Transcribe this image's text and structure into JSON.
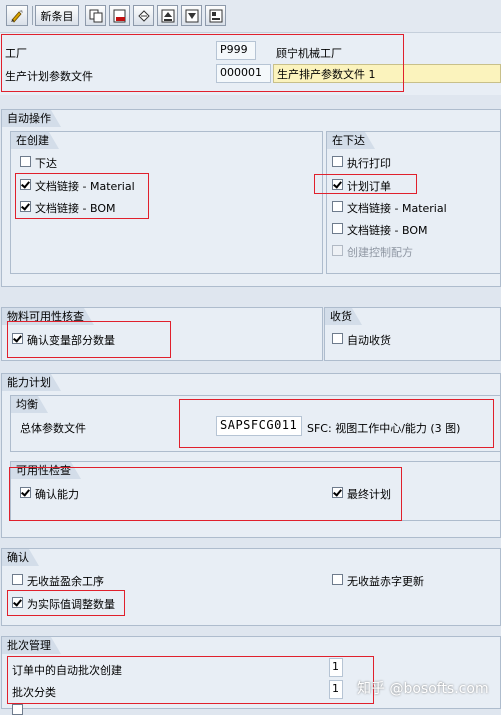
{
  "toolbar": {
    "new_entries_label": "新条目",
    "icons": [
      "edit-toggle-icon",
      "copy-icon",
      "delete-icon",
      "undo-icon",
      "select-all-icon",
      "deselect-icon",
      "details-icon"
    ]
  },
  "header": {
    "plant_label": "工厂",
    "plant_code": "P999",
    "plant_name": "顾宁机械工厂",
    "profile_label": "生产计划参数文件",
    "profile_code": "000001",
    "profile_desc": "生产排产参数文件 1"
  },
  "auto_actions": {
    "title": "自动操作",
    "on_create": {
      "title": "在创建",
      "release": {
        "label": "下达",
        "checked": false
      },
      "doc_link_material": {
        "label": "文档链接 - Material",
        "checked": true
      },
      "doc_link_bom": {
        "label": "文档链接 - BOM",
        "checked": true
      }
    },
    "on_release": {
      "title": "在下达",
      "execute_print": {
        "label": "执行打印",
        "checked": false
      },
      "planned_order": {
        "label": "计划订单",
        "checked": true
      },
      "doc_link_material": {
        "label": "文档链接 - Material",
        "checked": false
      },
      "doc_link_bom": {
        "label": "文档链接 - BOM",
        "checked": false
      },
      "create_control_recipe": {
        "label": "创建控制配方",
        "checked": false,
        "disabled": true
      }
    }
  },
  "material_check": {
    "title": "物料可用性核查",
    "confirm_variable_qty": {
      "label": "确认变量部分数量",
      "checked": true
    }
  },
  "goods_receipt": {
    "title": "收货",
    "auto_gr": {
      "label": "自动收货",
      "checked": false
    }
  },
  "capacity_planning": {
    "title": "能力计划",
    "leveling": {
      "title": "均衡",
      "overall_profile_label": "总体参数文件",
      "overall_profile_value": "SAPSFCG011",
      "overall_profile_desc": "SFC: 视图工作中心/能力 (3 图)"
    },
    "availability_check": {
      "title": "可用性检查",
      "confirm_capacity": {
        "label": "确认能力",
        "checked": true
      },
      "finite_scheduling": {
        "label": "最终计划",
        "checked": true
      }
    }
  },
  "confirmation": {
    "title": "确认",
    "no_gain_loss_op": {
      "label": "无收益盈余工序",
      "checked": false
    },
    "no_gain_red_update": {
      "label": "无收益赤字更新",
      "checked": false
    },
    "adjust_qty_actual": {
      "label": "为实际值调整数量",
      "checked": true
    }
  },
  "batch_management": {
    "title": "批次管理",
    "auto_batch_label": "订单中的自动批次创建",
    "auto_batch_value": "1",
    "batch_class_label": "批次分类",
    "batch_class_value": "1"
  },
  "watermark": "知乎 @bosofts.com"
}
